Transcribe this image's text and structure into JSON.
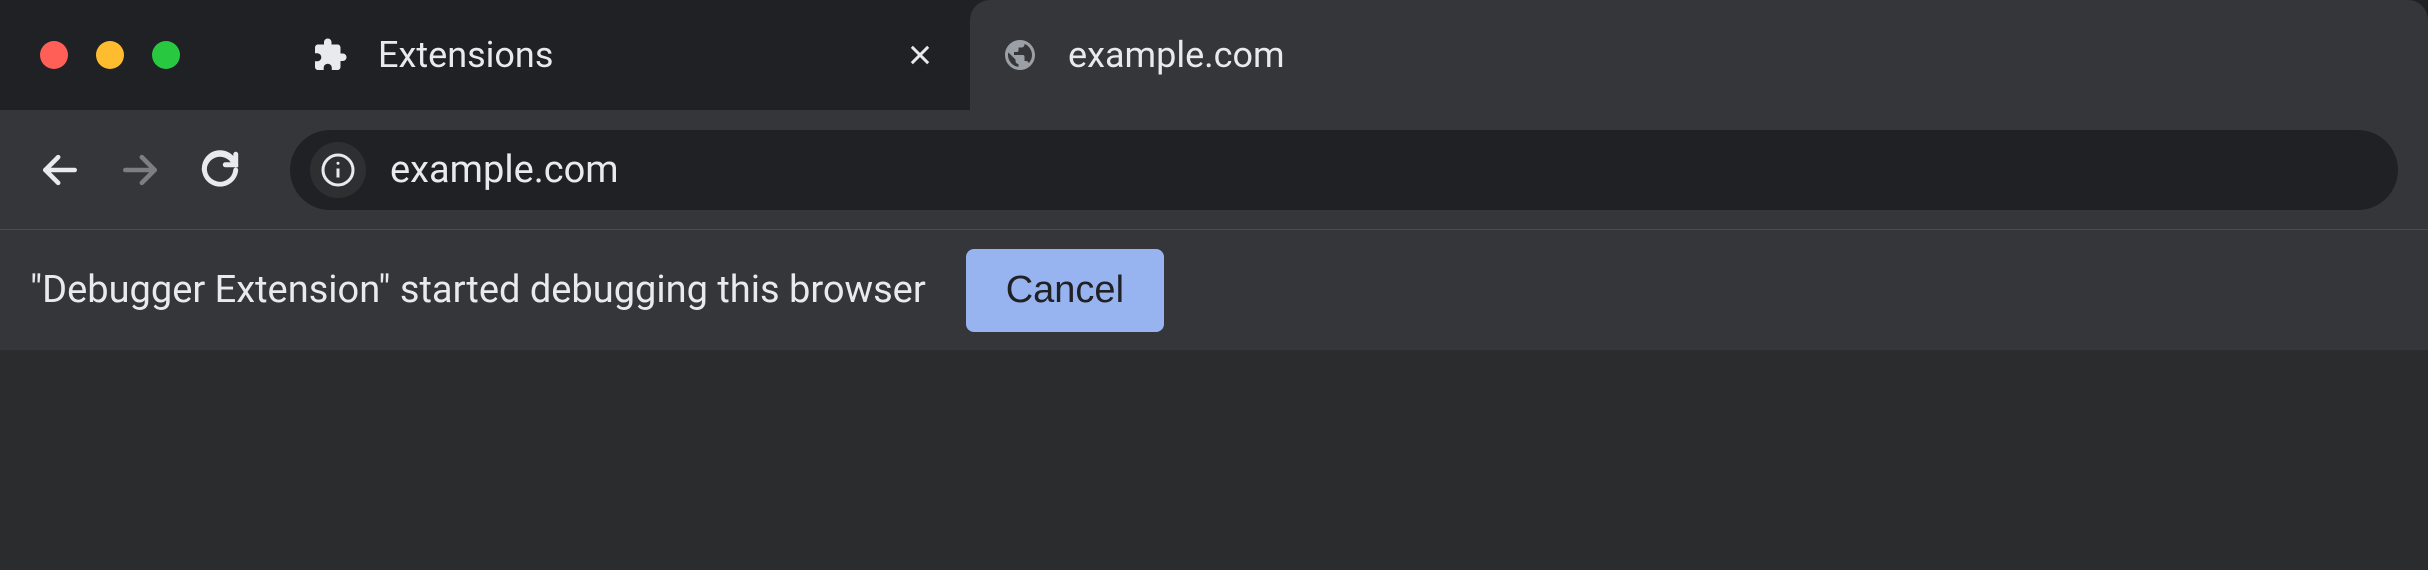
{
  "window_controls": {
    "close": "close",
    "minimize": "minimize",
    "maximize": "maximize"
  },
  "tabs": [
    {
      "title": "Extensions",
      "icon": "puzzle-piece",
      "active": false
    },
    {
      "title": "example.com",
      "icon": "globe",
      "active": true
    }
  ],
  "toolbar": {
    "back_enabled": true,
    "forward_enabled": false,
    "reload_enabled": true
  },
  "omnibox": {
    "url": "example.com",
    "security_icon": "info"
  },
  "infobar": {
    "message": "\"Debugger Extension\" started debugging this browser",
    "cancel_label": "Cancel"
  }
}
